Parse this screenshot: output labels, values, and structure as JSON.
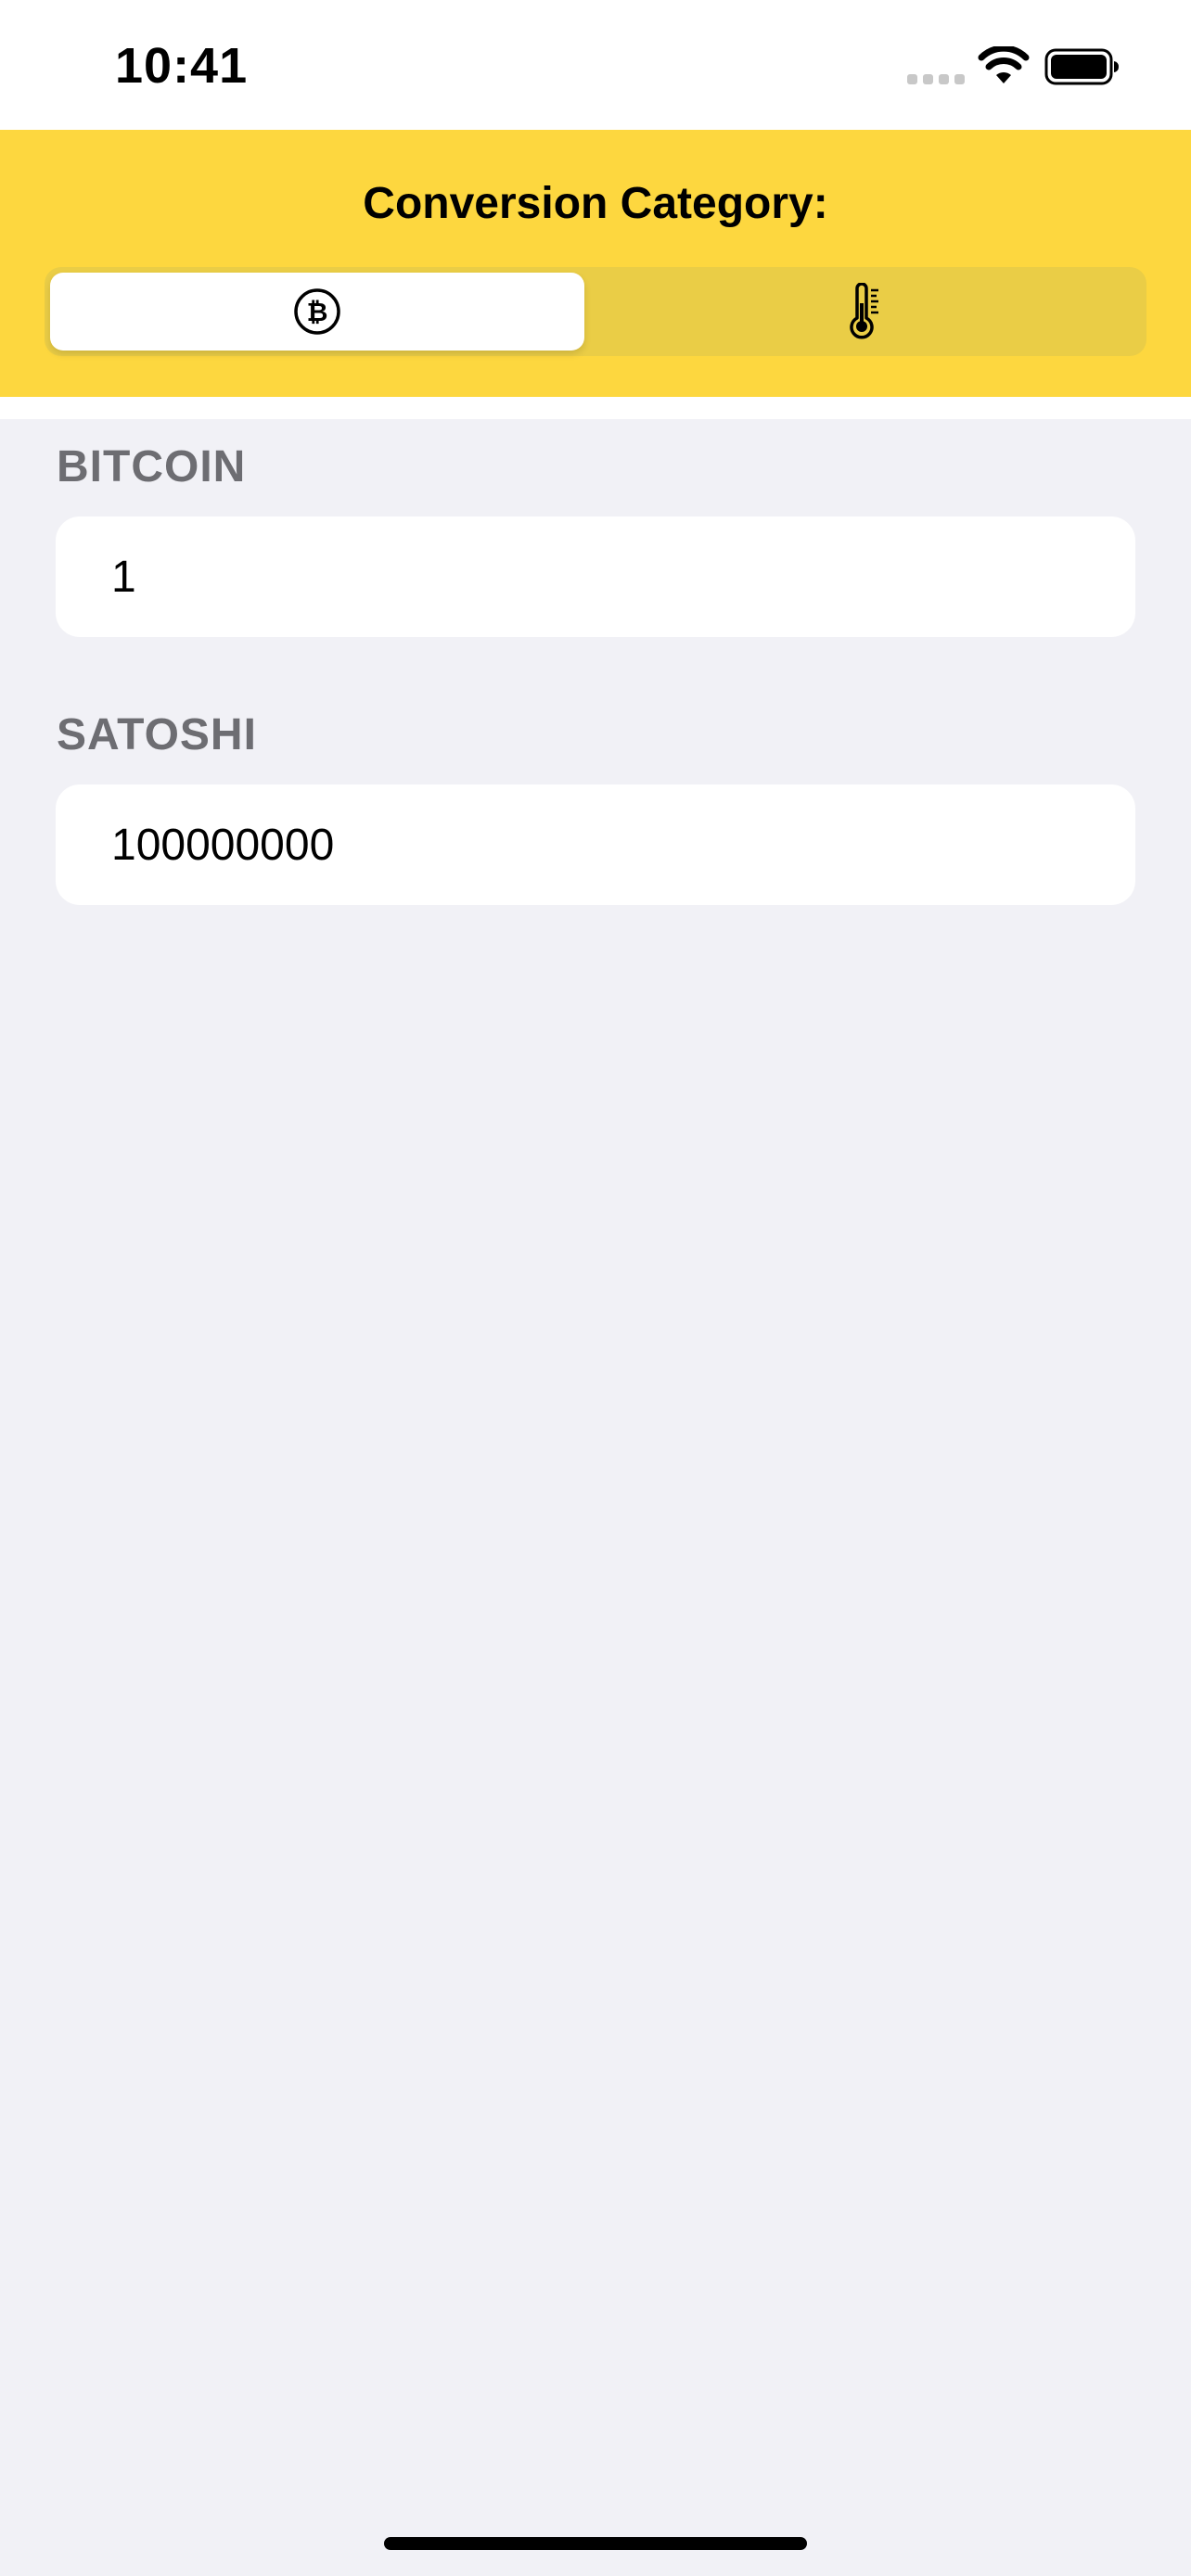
{
  "status_bar": {
    "time": "10:41"
  },
  "header": {
    "title": "Conversion Category:",
    "segments": [
      {
        "icon": "bitcoin-icon",
        "selected": true
      },
      {
        "icon": "thermometer-icon",
        "selected": false
      }
    ]
  },
  "fields": [
    {
      "label": "BITCOIN",
      "value": "1"
    },
    {
      "label": "SATOSHI",
      "value": "100000000"
    }
  ],
  "colors": {
    "header_background": "#fdd73f",
    "segmented_track": "#eacd46",
    "page_background": "#f1f1f6",
    "label_gray": "#6d6d72"
  }
}
